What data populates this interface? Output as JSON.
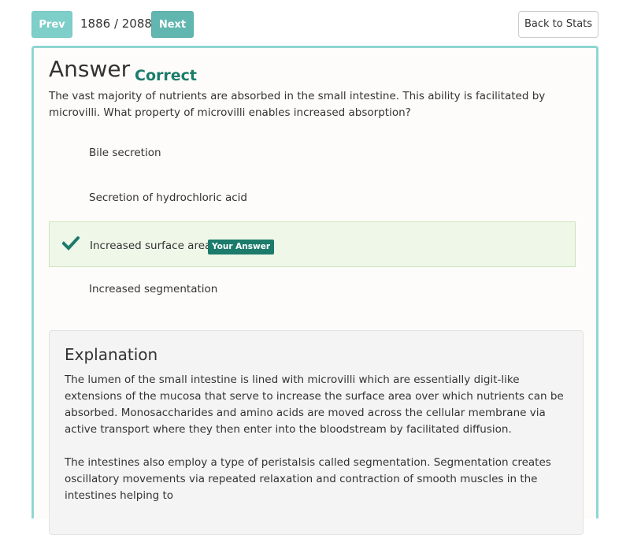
{
  "nav": {
    "prev_label": "Prev",
    "next_label": "Next",
    "counter": "1886 / 2088",
    "back_label": "Back to Stats"
  },
  "answer": {
    "heading": "Answer",
    "result": "Correct",
    "question": "The vast majority of nutrients are absorbed in the small intestine. This ability is facilitated by microvilli. What property of microvilli enables increased absorption?",
    "options": [
      {
        "label": "Bile secretion",
        "selected": false
      },
      {
        "label": "Secretion of hydrochloric acid",
        "selected": false
      },
      {
        "label": "Increased surface area",
        "selected": true,
        "badge": "Your Answer",
        "icon": "checkmark-icon"
      },
      {
        "label": "Increased segmentation",
        "selected": false
      }
    ]
  },
  "explanation": {
    "title": "Explanation",
    "paragraphs": [
      "The lumen of the small intestine is lined with microvilli which are essentially digit-like extensions of the mucosa that serve to increase the surface area over which nutrients can be absorbed. Monosaccharides and amino acids are moved across the cellular membrane via active transport where they then enter into the bloodstream by facilitated diffusion.",
      "The intestines also employ a type of peristalsis called segmentation. Segmentation creates oscillatory movements via repeated relaxation and contraction of smooth muscles in the intestines helping to"
    ]
  },
  "colors": {
    "accent": "#7ecfca",
    "next_button": "#62b6b0",
    "correct": "#1c7b6b",
    "selected_bg": "#eef7e8",
    "card_border": "#8fd6d1"
  }
}
